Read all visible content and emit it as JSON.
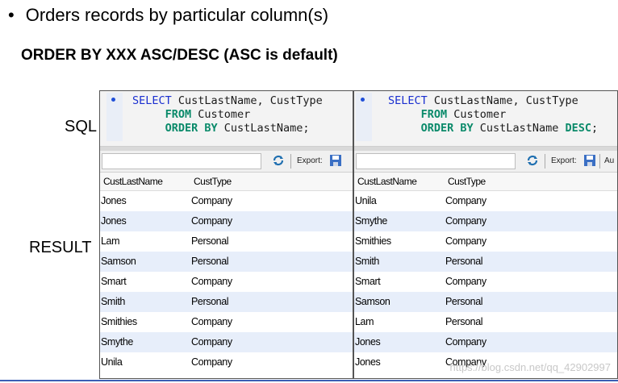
{
  "bullet": {
    "marker": "•",
    "text": "Orders records by particular column(s)"
  },
  "subheading": "ORDER BY XXX ASC/DESC (ASC is default)",
  "labels": {
    "sql": "SQL",
    "result": "RESULT"
  },
  "left_panel": {
    "sql": {
      "kw_select": "SELECT",
      "select_cols": " CustLastName, CustType",
      "kw_from": "FROM",
      "from_table": " Customer",
      "kw_order": "ORDER BY",
      "order_col": " CustLastName;"
    },
    "toolbar": {
      "export_label": "Export:"
    },
    "columns": [
      "CustLastName",
      "CustType"
    ],
    "rows": [
      [
        "Jones",
        "Company"
      ],
      [
        "Jones",
        "Company"
      ],
      [
        "Lam",
        "Personal"
      ],
      [
        "Samson",
        "Personal"
      ],
      [
        "Smart",
        "Company"
      ],
      [
        "Smith",
        "Personal"
      ],
      [
        "Smithies",
        "Company"
      ],
      [
        "Smythe",
        "Company"
      ],
      [
        "Unila",
        "Company"
      ]
    ]
  },
  "right_panel": {
    "sql": {
      "kw_select": "SELECT",
      "select_cols": " CustLastName, CustType",
      "kw_from": "FROM",
      "from_table": " Customer",
      "kw_order": "ORDER BY",
      "order_col": " CustLastName ",
      "kw_desc": "DESC",
      "terminator": ";"
    },
    "toolbar": {
      "export_label": "Export:",
      "extra_label": "Au"
    },
    "columns": [
      "CustLastName",
      "CustType"
    ],
    "rows": [
      [
        "Unila",
        "Company"
      ],
      [
        "Smythe",
        "Company"
      ],
      [
        "Smithies",
        "Company"
      ],
      [
        "Smith",
        "Personal"
      ],
      [
        "Smart",
        "Company"
      ],
      [
        "Samson",
        "Personal"
      ],
      [
        "Lam",
        "Personal"
      ],
      [
        "Jones",
        "Company"
      ],
      [
        "Jones",
        "Company"
      ]
    ]
  },
  "watermark": "https://blog.csdn.net/qq_42902997",
  "colors": {
    "keyword_blue": "#1a2fd0",
    "keyword_green": "#0a8a6a",
    "row_alt": "#e7eefa"
  }
}
